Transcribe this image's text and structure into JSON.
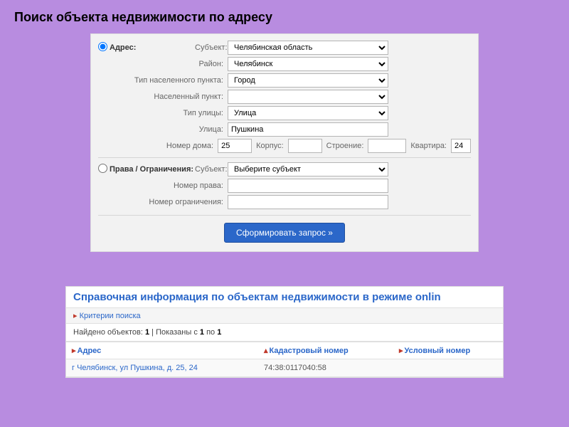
{
  "slide_title": "Поиск объекта недвижимости по адресу",
  "form": {
    "radio_address": "Адрес:",
    "subject_label": "Субъект:",
    "subject_value": "Челябинская область",
    "district_label": "Район:",
    "district_value": "Челябинск",
    "settlement_type_label": "Тип населенного пункта:",
    "settlement_type_value": "Город",
    "settlement_label": "Населенный пункт:",
    "settlement_value": "",
    "street_type_label": "Тип улицы:",
    "street_type_value": "Улица",
    "street_label": "Улица:",
    "street_value": "Пушкина",
    "house_label": "Номер дома:",
    "house_value": "25",
    "korpus_label": "Корпус:",
    "korpus_value": "",
    "building_label": "Строение:",
    "building_value": "",
    "flat_label": "Квартира:",
    "flat_value": "24",
    "radio_rights": "Права / Ограничения:",
    "rights_subject_label": "Субъект:",
    "rights_subject_value": "Выберите субъект",
    "right_no_label": "Номер права:",
    "right_no_value": "",
    "restriction_no_label": "Номер ограничения:",
    "restriction_no_value": "",
    "submit_label": "Сформировать запрос »"
  },
  "results": {
    "title": "Справочная информация по объектам недвижимости в режиме onlin",
    "criteria_label": "Критерии поиска",
    "found_prefix": "Найдено объектов: ",
    "found_count": "1",
    "shown_mid": " | Показаны с ",
    "shown_from": "1",
    "shown_mid2": " по ",
    "shown_to": "1",
    "col_address": "Адрес",
    "col_cadastral": "Кадастровый номер",
    "col_conditional": "Условный номер",
    "row": {
      "address": "г Челябинск, ул Пушкина, д. 25, 24",
      "cadastral": "74:38:0117040:58",
      "conditional": ""
    }
  }
}
